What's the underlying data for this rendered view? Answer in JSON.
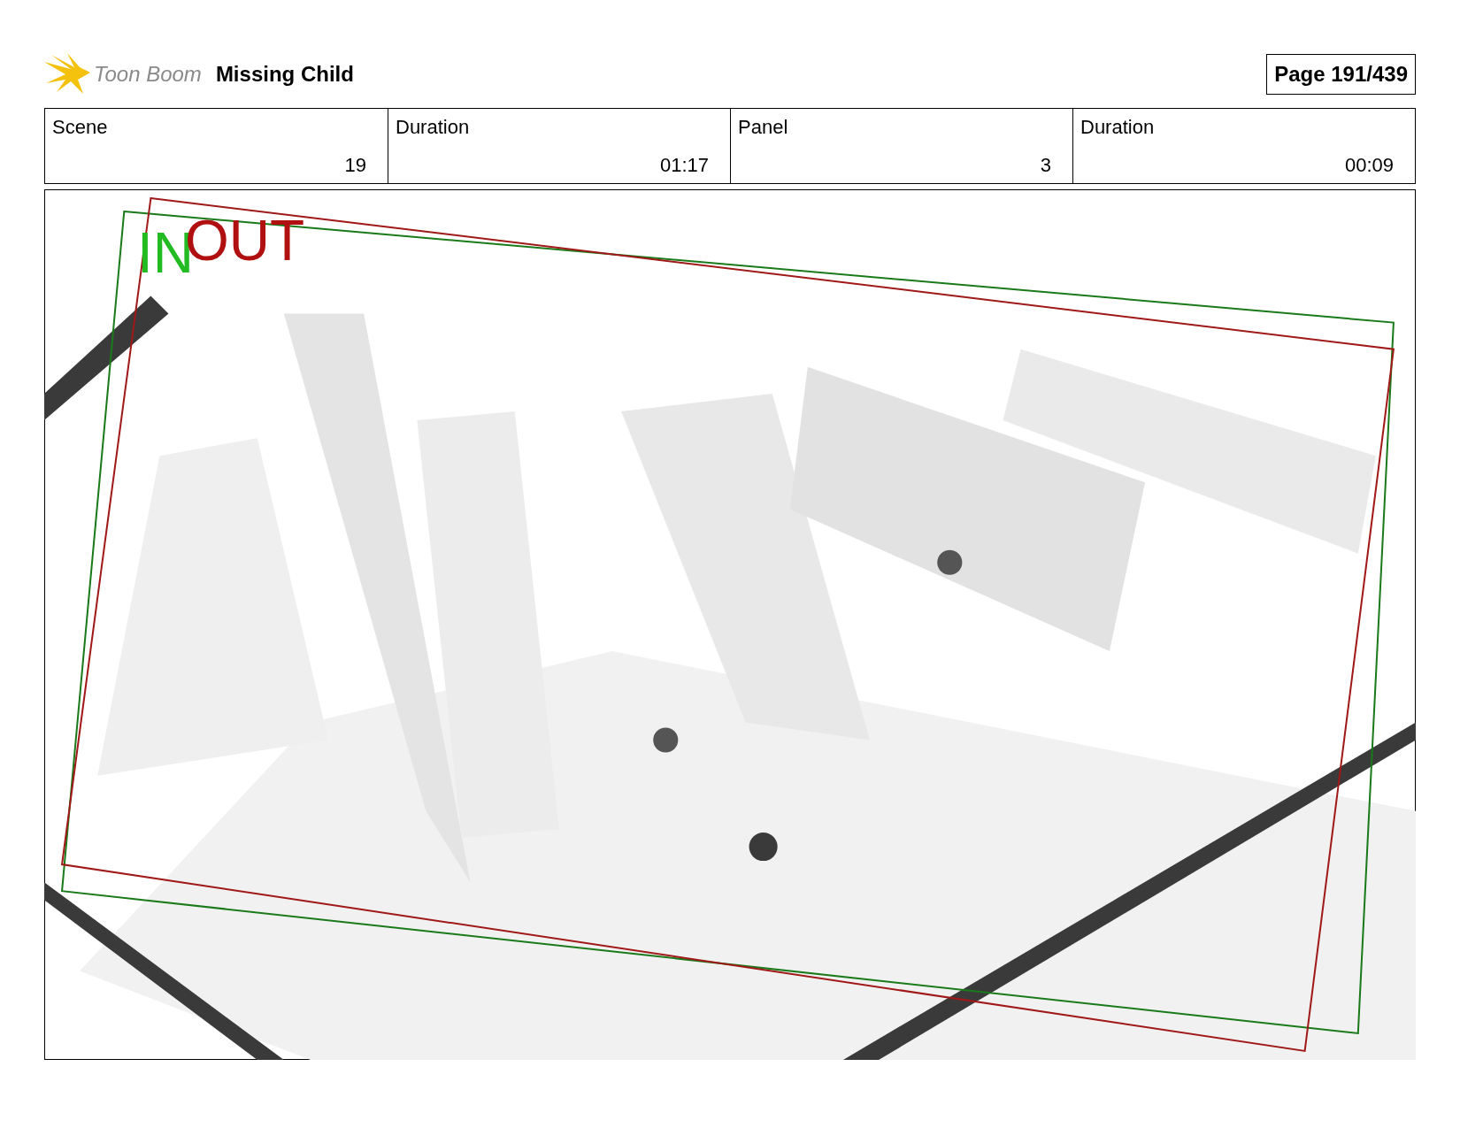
{
  "header": {
    "logo_text": "Toon Boom",
    "title": "Missing Child",
    "page": "Page 191/439"
  },
  "fields": [
    {
      "label": "Scene",
      "value": "19"
    },
    {
      "label": "Duration",
      "value": "01:17"
    },
    {
      "label": "Panel",
      "value": "3"
    },
    {
      "label": "Duration",
      "value": "00:09"
    }
  ],
  "panel": {
    "in_label": "IN",
    "out_label": "OUT"
  }
}
